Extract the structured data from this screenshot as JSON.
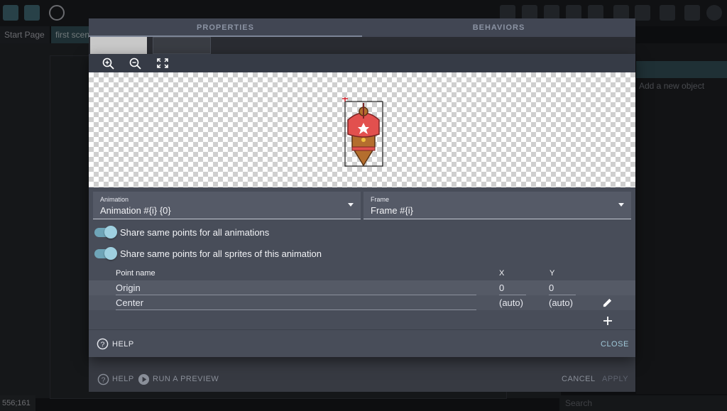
{
  "editor": {
    "tabs": [
      "Start Page",
      "first scene"
    ],
    "new_object_label": "Add a new object",
    "cursor_coords": "556;161",
    "search_placeholder": "Search"
  },
  "outer_dialog": {
    "tabs": [
      "PROPERTIES",
      "BEHAVIORS"
    ],
    "footer": {
      "help_label": "HELP",
      "preview_label": "RUN A PREVIEW",
      "cancel_label": "CANCEL",
      "apply_label": "APPLY"
    }
  },
  "points_editor": {
    "toolbar": {
      "icons": [
        "zoom-in-icon",
        "zoom-out-icon",
        "fit-screen-icon"
      ]
    },
    "animation_select": {
      "label": "Animation",
      "value": "Animation #{i} {0}"
    },
    "frame_select": {
      "label": "Frame",
      "value": "Frame #{i}"
    },
    "toggles": [
      {
        "label": "Share same points for all animations",
        "on": true
      },
      {
        "label": "Share same points for all sprites of this animation",
        "on": true
      }
    ],
    "table": {
      "headers": {
        "name": "Point name",
        "x": "X",
        "y": "Y"
      },
      "rows": [
        {
          "name": "Origin",
          "x": "0",
          "y": "0"
        },
        {
          "name": "Center",
          "x": "(auto)",
          "y": "(auto)"
        }
      ]
    },
    "footer": {
      "help_label": "HELP",
      "close_label": "CLOSE"
    },
    "colors": {
      "accent": "#6fa5b8",
      "close": "#9fc8d8",
      "origin_marker": "#d0202a"
    }
  }
}
